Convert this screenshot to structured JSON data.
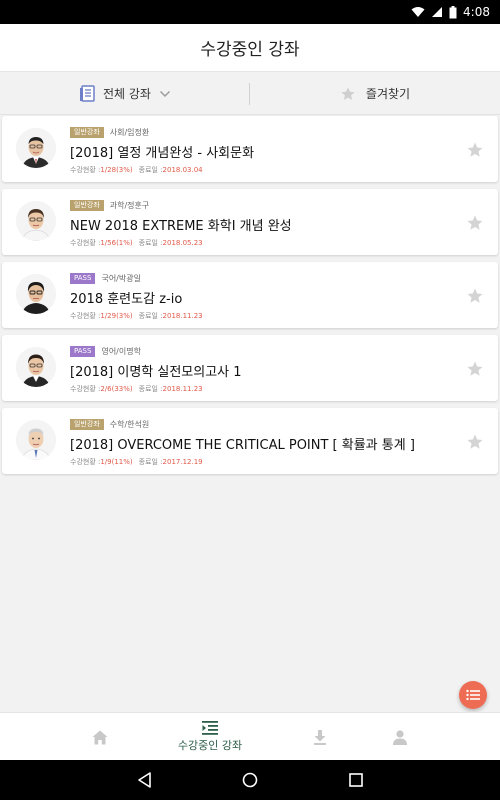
{
  "status_bar": {
    "time": "4:08"
  },
  "header": {
    "title": "수강중인 강좌"
  },
  "filter": {
    "all_label": "전체 강좌",
    "favorites_label": "즐겨찾기"
  },
  "courses": [
    {
      "badge": "일반강좌",
      "badge_type": "normal",
      "teacher": "사회/임정환",
      "title": "[2018] 열정 개념완성 - 사회문화",
      "progress_label": "수강현황 :",
      "progress": "1/28(3%)",
      "end_label": "종료일 :",
      "end_date": "2018.03.04"
    },
    {
      "badge": "일반강좌",
      "badge_type": "normal",
      "teacher": "과학/정훈구",
      "title": "NEW 2018 EXTREME 화학I 개념 완성",
      "progress_label": "수강현황 :",
      "progress": "1/56(1%)",
      "end_label": "종료일 :",
      "end_date": "2018.05.23"
    },
    {
      "badge": "PASS",
      "badge_type": "pass",
      "teacher": "국어/박광일",
      "title": "2018 훈련도감 z-io",
      "progress_label": "수강현황 :",
      "progress": "1/29(3%)",
      "end_label": "종료일 :",
      "end_date": "2018.11.23"
    },
    {
      "badge": "PASS",
      "badge_type": "pass",
      "teacher": "영어/이명학",
      "title": "[2018] 이명학 실전모의고사 1",
      "progress_label": "수강현황 :",
      "progress": "2/6(33%)",
      "end_label": "종료일 :",
      "end_date": "2018.11.23"
    },
    {
      "badge": "일반강좌",
      "badge_type": "normal",
      "teacher": "수학/한석원",
      "title": "[2018] OVERCOME THE CRITICAL POINT [ 확률과 통계 ]",
      "progress_label": "수강현황 :",
      "progress": "1/9(11%)",
      "end_label": "종료일 :",
      "end_date": "2017.12.19"
    }
  ],
  "bottom_nav": {
    "active_label": "수강중인 강좌"
  },
  "colors": {
    "accent_green": "#2e5e4a",
    "badge_normal": "#b9a26d",
    "badge_pass": "#9b78c9",
    "fab": "#ee6c53",
    "progress_red": "#e05a4a"
  }
}
